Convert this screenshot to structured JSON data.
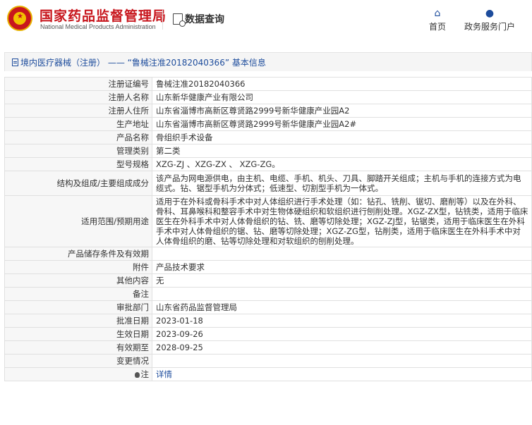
{
  "header": {
    "site_name_cn": "国家药品监督管理局",
    "site_name_en": "National Medical Products Administration",
    "query_label": "数据查询",
    "nav": [
      {
        "label": "首页",
        "icon": "home-icon"
      },
      {
        "label": "政务服务门户",
        "icon": "user-icon"
      }
    ]
  },
  "title": {
    "text": "境内医疗器械（注册） —— “鲁械注准20182040366” 基本信息"
  },
  "colors": {
    "brand_red": "#c8161d",
    "link_blue": "#1d4c9c"
  },
  "rows": [
    {
      "label": "注册证编号",
      "value": "鲁械注准20182040366"
    },
    {
      "label": "注册人名称",
      "value": "山东新华健康产业有限公司"
    },
    {
      "label": "注册人住所",
      "value": "山东省淄博市高新区尊贤路2999号新华健康产业园A2"
    },
    {
      "label": "生产地址",
      "value": "山东省淄博市高新区尊贤路2999号新华健康产业园A2#"
    },
    {
      "label": "产品名称",
      "value": "骨组织手术设备"
    },
    {
      "label": "管理类别",
      "value": "第二类"
    },
    {
      "label": "型号规格",
      "value": "XZG-ZJ 、XZG-ZX 、 XZG-ZG。"
    },
    {
      "label": "结构及组成/主要组成成分",
      "value": "该产品为网电源供电，由主机、电缆、手机、机头、刀具、脚踏开关组成；主机与手机的连接方式为电缆式。钻、锯型手机为分体式；低速型、切割型手机为一体式。"
    },
    {
      "label": "适用范围/预期用途",
      "value": "适用于在外科或骨科手术中对人体组织进行手术处理（如：钻孔、铣削、锯切、磨削等）以及在外科、骨科、耳鼻喉科和整容手术中对生物体硬组织和软组织进行刨削处理。XGZ-ZX型，钻铣类，适用于临床医生在外科手术中对人体骨组织的钻、铣、磨等切除处理；XGZ-ZJ型，钻锯类，适用于临床医生在外科手术中对人体骨组织的锯、钻、磨等切除处理；XGZ-ZG型，钻削类，适用于临床医生在外科手术中对人体骨组织的磨、钻等切除处理和对软组织的刨削处理。"
    },
    {
      "label": "产品储存条件及有效期",
      "value": ""
    },
    {
      "label": "附件",
      "value": "产品技术要求"
    },
    {
      "label": "其他内容",
      "value": "无"
    },
    {
      "label": "备注",
      "value": ""
    },
    {
      "label": "审批部门",
      "value": "山东省药品监督管理局"
    },
    {
      "label": "批准日期",
      "value": "2023-01-18"
    },
    {
      "label": "生效日期",
      "value": "2023-09-26"
    },
    {
      "label": "有效期至",
      "value": "2028-09-25"
    },
    {
      "label": "变更情况",
      "value": ""
    }
  ],
  "note": {
    "label": "注",
    "link_text": "详情",
    "icon": "lightbulb-icon"
  }
}
